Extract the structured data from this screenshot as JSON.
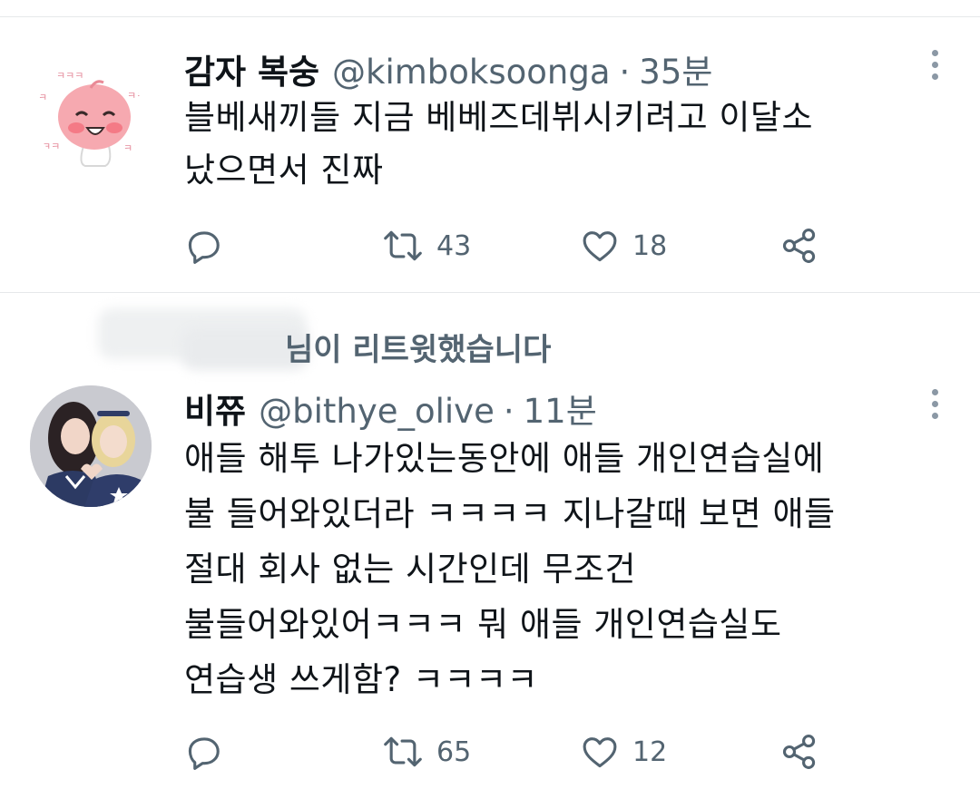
{
  "tweets": [
    {
      "author": {
        "name": "감자 복숭",
        "handle": "@kimboksoonga",
        "avatar_icon": "peach-character-avatar"
      },
      "separator": "·",
      "time": "35분",
      "text": "블베새끼들 지금 베베즈데뷔시키려고 이달소\n났으면서 진짜",
      "stats": {
        "retweets": "43",
        "likes": "18"
      }
    },
    {
      "retweeted_label": "님이 리트윗했습니다",
      "author": {
        "name": "비쮸",
        "handle": "@bithye_olive",
        "avatar_icon": "two-girls-photo-avatar"
      },
      "separator": "·",
      "time": "11분",
      "text": "애들 해투 나가있는동안에 애들 개인연습실에\n불 들어와있더라 ㅋㅋㅋㅋ 지나갈때 보면 애들\n절대 회사 없는 시간인데 무조건\n불들어와있어ㅋㅋㅋ 뭐 애들 개인연습실도\n연습생 쓰게함? ㅋㅋㅋㅋ",
      "stats": {
        "retweets": "65",
        "likes": "12"
      }
    }
  ],
  "icons": [
    "reply-icon",
    "retweet-icon",
    "like-icon",
    "share-icon",
    "more-options-icon"
  ],
  "colors": {
    "text": "#0f1419",
    "secondary": "#536471",
    "divider": "#e6e8ea"
  }
}
